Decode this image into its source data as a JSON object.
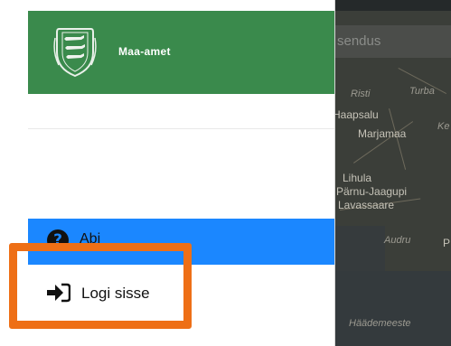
{
  "brand": {
    "name": "Maa-amet",
    "emblem_icon": "coat-of-arms-icon",
    "header_color": "#3a8a4c"
  },
  "menu": {
    "help": {
      "label": "Abi",
      "icon": "question-circle-icon",
      "bg_color": "#1b87ff"
    },
    "login": {
      "label": "Logi sisse",
      "icon": "sign-in-icon"
    }
  },
  "highlight": {
    "color": "#ee6f16"
  },
  "map": {
    "search_placeholder": "sendus",
    "places": [
      "Risti",
      "Turba",
      "Ke",
      "Haapsalu",
      "Marjamaa",
      "Lihula",
      "Pärnu-Jaagupi",
      "Lavassaare",
      "Audru",
      "P",
      "Häädemeeste"
    ]
  }
}
